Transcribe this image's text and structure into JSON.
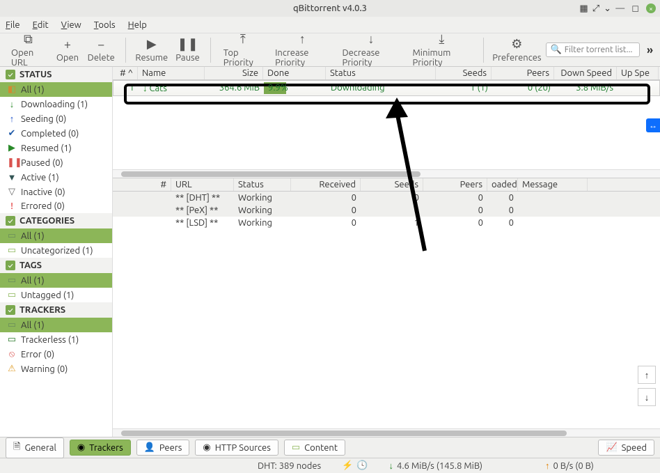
{
  "window": {
    "title": "qBittorrent v4.0.3"
  },
  "menu": {
    "file": "File",
    "edit": "Edit",
    "view": "View",
    "tools": "Tools",
    "help": "Help"
  },
  "toolbar": {
    "open_url": "Open URL",
    "open": "Open",
    "delete": "Delete",
    "resume": "Resume",
    "pause": "Pause",
    "top_priority": "Top Priority",
    "increase_priority": "Increase Priority",
    "decrease_priority": "Decrease Priority",
    "minimum_priority": "Minimum Priority",
    "preferences": "Preferences",
    "filter_placeholder": "Filter torrent list..."
  },
  "sidebar": {
    "status_head": "STATUS",
    "status": {
      "all": "All (1)",
      "downloading": "Downloading (1)",
      "seeding": "Seeding (0)",
      "completed": "Completed (0)",
      "resumed": "Resumed (1)",
      "paused": "Paused (0)",
      "active": "Active (1)",
      "inactive": "Inactive (0)",
      "errored": "Errored (0)"
    },
    "categories_head": "CATEGORIES",
    "categories": {
      "all": "All (1)",
      "uncategorized": "Uncategorized (1)"
    },
    "tags_head": "TAGS",
    "tags": {
      "all": "All (1)",
      "untagged": "Untagged (1)"
    },
    "trackers_head": "TRACKERS",
    "trackers": {
      "all": "All (1)",
      "trackerless": "Trackerless (1)",
      "error": "Error (0)",
      "warning": "Warning (0)"
    }
  },
  "columns": {
    "num": "#",
    "name": "Name",
    "size": "Size",
    "done": "Done",
    "status": "Status",
    "seeds": "Seeds",
    "peers": "Peers",
    "down_speed": "Down Speed",
    "up_speed": "Up Spe"
  },
  "torrent": {
    "num": "1",
    "name": "Cats",
    "size": "364.6 MiB",
    "done_pct": "9.9%",
    "status": "Downloading",
    "seeds": "1 (1)",
    "peers": "0 (20)",
    "down_speed": "3.8 MiB/s"
  },
  "tracker_cols": {
    "num": "#",
    "url": "URL",
    "status": "Status",
    "received": "Received",
    "seeds": "Seeds",
    "peers": "Peers",
    "loaded": "oaded",
    "message": "Message"
  },
  "trackers_rows": {
    "r0": {
      "url": "** [DHT] **",
      "status": "Working",
      "recv": "0",
      "seeds": "0",
      "peers": "0",
      "loaded": "0"
    },
    "r1": {
      "url": "** [PeX] **",
      "status": "Working",
      "recv": "0",
      "seeds": "0",
      "peers": "0",
      "loaded": "0"
    },
    "r2": {
      "url": "** [LSD] **",
      "status": "Working",
      "recv": "0",
      "seeds": "1",
      "peers": "0",
      "loaded": "0"
    }
  },
  "tabs": {
    "general": "General",
    "trackers": "Trackers",
    "peers": "Peers",
    "http_sources": "HTTP Sources",
    "content": "Content",
    "speed": "Speed"
  },
  "status": {
    "dht": "DHT: 389 nodes",
    "down": "4.6 MiB/s (145.8 MiB)",
    "up": "0 B/s (0 B)"
  }
}
